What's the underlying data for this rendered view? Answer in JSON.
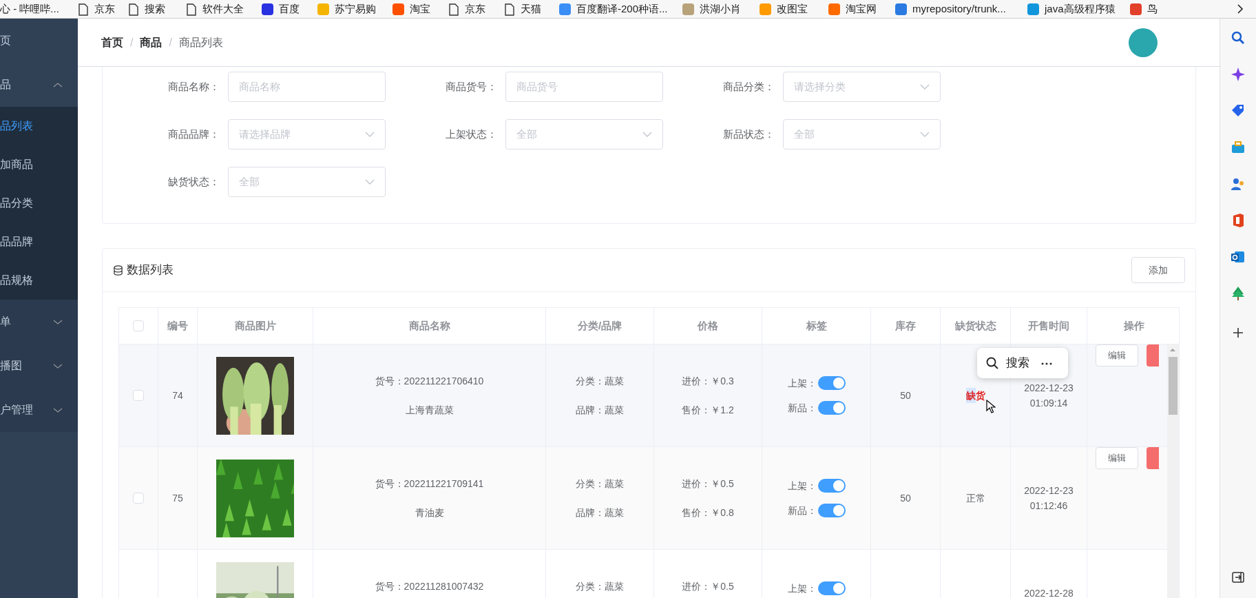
{
  "bookmarks": [
    {
      "label": "心 - 哔哩哔..."
    },
    {
      "label": "京东",
      "kind": "page"
    },
    {
      "label": "搜索",
      "kind": "page"
    },
    {
      "label": "软件大全",
      "kind": "page"
    },
    {
      "label": "百度",
      "kind": "site",
      "color": "#2932e1"
    },
    {
      "label": "苏宁易购",
      "kind": "site",
      "color": "#f5b400"
    },
    {
      "label": "淘宝",
      "kind": "site",
      "color": "#ff5000"
    },
    {
      "label": "京东",
      "kind": "page"
    },
    {
      "label": "天猫",
      "kind": "page"
    },
    {
      "label": "百度翻译-200种语...",
      "kind": "site",
      "color": "#3a8ef6"
    },
    {
      "label": "洪湖小肖",
      "kind": "site",
      "color": "#b8a27a"
    },
    {
      "label": "改图宝",
      "kind": "site",
      "color": "#ff9a00"
    },
    {
      "label": "淘宝网",
      "kind": "site",
      "color": "#ff6a00"
    },
    {
      "label": "myrepository/trunk...",
      "kind": "site",
      "color": "#2a7ae2"
    },
    {
      "label": "java高级程序猿",
      "kind": "site",
      "color": "#1296db"
    },
    {
      "label": "鸟",
      "kind": "site",
      "color": "#e2402b"
    }
  ],
  "sidebar": {
    "items": [
      {
        "label": "页"
      },
      {
        "label": "品",
        "expanded": true,
        "children": [
          {
            "label": "品列表",
            "selected": true
          },
          {
            "label": "加商品",
            "selected": false
          },
          {
            "label": "品分类",
            "selected": false
          },
          {
            "label": "品品牌",
            "selected": false
          },
          {
            "label": "品规格",
            "selected": false
          }
        ]
      },
      {
        "label": "单",
        "expanded": false
      },
      {
        "label": "播图",
        "expanded": false
      },
      {
        "label": "户管理",
        "expanded": false
      }
    ]
  },
  "breadcrumb": {
    "items": [
      "首页",
      "商品",
      "商品列表"
    ],
    "separators": [
      "/",
      "/"
    ]
  },
  "filters": [
    {
      "label": "商品名称：",
      "placeholder": "商品名称",
      "kind": "text"
    },
    {
      "label": "商品货号：",
      "placeholder": "商品货号",
      "kind": "text"
    },
    {
      "label": "商品分类：",
      "placeholder": "请选择分类",
      "kind": "select"
    },
    {
      "label": "商品品牌：",
      "placeholder": "请选择品牌",
      "kind": "select"
    },
    {
      "label": "上架状态：",
      "placeholder": "全部",
      "kind": "select"
    },
    {
      "label": "新品状态：",
      "placeholder": "全部",
      "kind": "select"
    },
    {
      "label": "缺货状态：",
      "placeholder": "全部",
      "kind": "select"
    }
  ],
  "data_list": {
    "title": "数据列表",
    "add_button": "添加"
  },
  "table": {
    "select_all_checked": false,
    "columns": [
      "编号",
      "商品图片",
      "商品名称",
      "分类/品牌",
      "价格",
      "标签",
      "库存",
      "缺货状态",
      "开售时间",
      "操作"
    ],
    "rows": [
      {
        "checked": false,
        "id": "74",
        "sku": "货号：202211221706410",
        "name": "上海青蔬菜",
        "category": "分类：蔬菜",
        "brand": "品牌：蔬菜",
        "cost": "进价：￥0.3",
        "price": "售价：￥1.2",
        "tags": [
          {
            "label": "上架：",
            "on": true
          },
          {
            "label": "新品：",
            "on": true
          }
        ],
        "stock": "50",
        "stock_status": "缺货",
        "color": "#e02020",
        "highlighted": true,
        "sale_date": "2022-12-23",
        "sale_time": "01:09:14",
        "edit_button": "编辑"
      },
      {
        "checked": false,
        "id": "75",
        "sku": "货号：202211221709141",
        "name": "青油麦",
        "category": "分类：蔬菜",
        "brand": "品牌：蔬菜",
        "cost": "进价：￥0.5",
        "price": "售价：￥0.8",
        "tags": [
          {
            "label": "上架：",
            "on": true
          },
          {
            "label": "新品：",
            "on": true
          }
        ],
        "stock": "50",
        "stock_status": "正常",
        "color": "#606266",
        "highlighted": false,
        "sale_date": "2022-12-23",
        "sale_time": "01:12:46",
        "edit_button": "编辑"
      },
      {
        "sku": "货号：202211281007432",
        "category": "分类：蔬菜",
        "cost": "进价：￥0.5",
        "tags": [
          {
            "label": "上架：",
            "on": true
          }
        ],
        "sale_date": "2022-12-28"
      }
    ]
  },
  "popup": {
    "label": "搜索",
    "more": "⋯"
  }
}
